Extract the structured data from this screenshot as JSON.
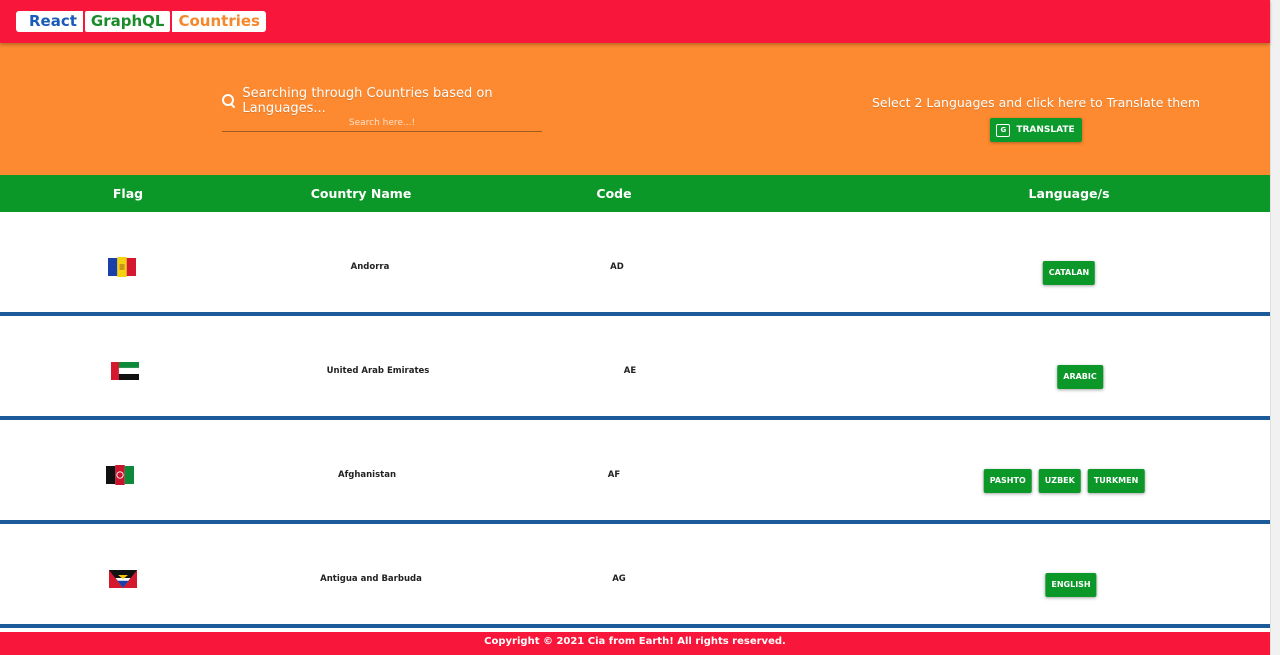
{
  "header": {
    "logo": {
      "react": "React",
      "graphql": "GraphQL",
      "countries": "Countries"
    }
  },
  "search": {
    "label": "Searching through Countries based on Languages...",
    "placeholder": "Search here...!",
    "value": ""
  },
  "translate": {
    "text": "Select 2 Languages and click here to Translate them",
    "button_label": "TRANSLATE"
  },
  "table": {
    "headers": [
      "Flag",
      "Country Name",
      "Code",
      "Language/s"
    ],
    "rows": [
      {
        "flag": "flag-andorra-icon",
        "name": "Andorra",
        "code": "AD",
        "languages": [
          "CATALAN"
        ]
      },
      {
        "flag": "flag-uae-icon",
        "name": "United Arab Emirates",
        "code": "AE",
        "languages": [
          "ARABIC"
        ]
      },
      {
        "flag": "flag-afghanistan-icon",
        "name": "Afghanistan",
        "code": "AF",
        "languages": [
          "PASHTO",
          "UZBEK",
          "TURKMEN"
        ]
      },
      {
        "flag": "flag-antigua-barbuda-icon",
        "name": "Antigua and Barbuda",
        "code": "AG",
        "languages": [
          "ENGLISH"
        ]
      }
    ]
  },
  "footer": {
    "text": "Copyright © 2021  Cia from Earth! All rights reserved."
  },
  "colors": {
    "topbar": "#f8173a",
    "hero": "#fd8a30",
    "table_header": "#0b9829",
    "row_divider": "#1c5a9a",
    "chip": "#0b9829"
  }
}
